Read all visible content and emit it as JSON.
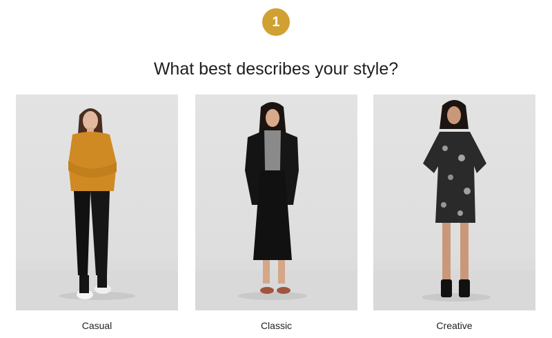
{
  "step": {
    "number": "1"
  },
  "question": "What best describes your style?",
  "options": [
    {
      "label": "Casual"
    },
    {
      "label": "Classic"
    },
    {
      "label": "Creative"
    }
  ],
  "colors": {
    "accent": "#d0a032",
    "photo_background": "#e0e0e0",
    "text": "#1e1e1e"
  }
}
